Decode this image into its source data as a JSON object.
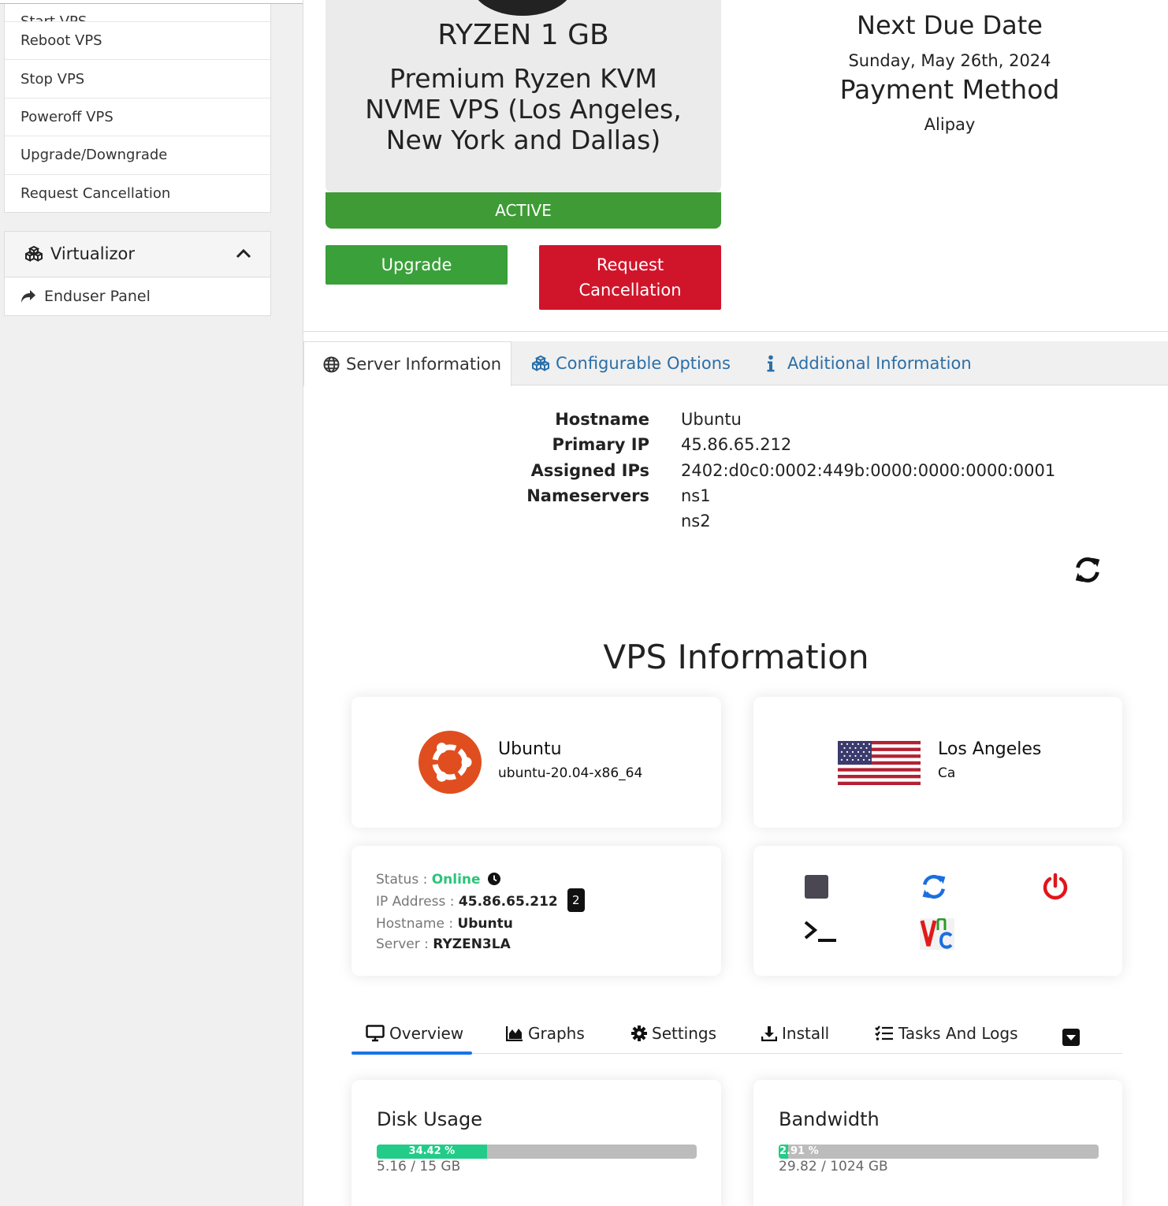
{
  "sidebar": {
    "actions": [
      "Start VPS",
      "Reboot VPS",
      "Stop VPS",
      "Poweroff VPS",
      "Upgrade/Downgrade",
      "Request Cancellation"
    ],
    "virtualizor": {
      "title": "Virtualizor",
      "items": [
        "Enduser Panel"
      ]
    }
  },
  "product": {
    "name": "RYZEN 1 GB",
    "description": "Premium Ryzen KVM NVME VPS (Los Angeles, New York and Dallas)",
    "status": "ACTIVE",
    "upgrade_label": "Upgrade",
    "cancel_label": "Request Cancellation"
  },
  "billing": {
    "next_due_label": "Next Due Date",
    "next_due_value": "Sunday, May 26th, 2024",
    "payment_label": "Payment Method",
    "payment_value": "Alipay"
  },
  "tabs": [
    "Server Information",
    "Configurable Options",
    "Additional Information"
  ],
  "server_info": {
    "rows": [
      {
        "label": "Hostname",
        "value": "Ubuntu"
      },
      {
        "label": "Primary IP",
        "value": "45.86.65.212"
      },
      {
        "label": "Assigned IPs",
        "value": "2402:d0c0:0002:449b:0000:0000:0000:0001"
      },
      {
        "label": "Nameservers",
        "value": "ns1"
      },
      {
        "label": "",
        "value": "ns2"
      }
    ]
  },
  "vps": {
    "title": "VPS Information",
    "os_name": "Ubuntu",
    "os_version": "ubuntu-20.04-x86_64",
    "location_city": "Los Angeles",
    "location_region": "Ca",
    "status_label": "Status : ",
    "status_value": "Online",
    "ip_label": "IP Address : ",
    "ip_value": "45.86.65.212",
    "ip_count": "2",
    "hostname_label": "Hostname : ",
    "hostname_value": "Ubuntu",
    "server_label": "Server : ",
    "server_value": "RYZEN3LA",
    "subtabs": [
      "Overview",
      "Graphs",
      "Settings",
      "Install",
      "Tasks And Logs"
    ],
    "disk": {
      "title": "Disk Usage",
      "percent_label": "34.42 %",
      "percent": 34.42,
      "usage": "5.16 / 15 GB"
    },
    "bandwidth": {
      "title": "Bandwidth",
      "percent_label": "2.91 %",
      "percent": 2.91,
      "usage": "29.82 / 1024 GB"
    }
  },
  "colors": {
    "active_green": "#3e9b35",
    "cancel_red": "#d0152b",
    "link_blue": "#2a6fa8",
    "online_green": "#2bc47a",
    "progress_green": "#22cc88"
  }
}
